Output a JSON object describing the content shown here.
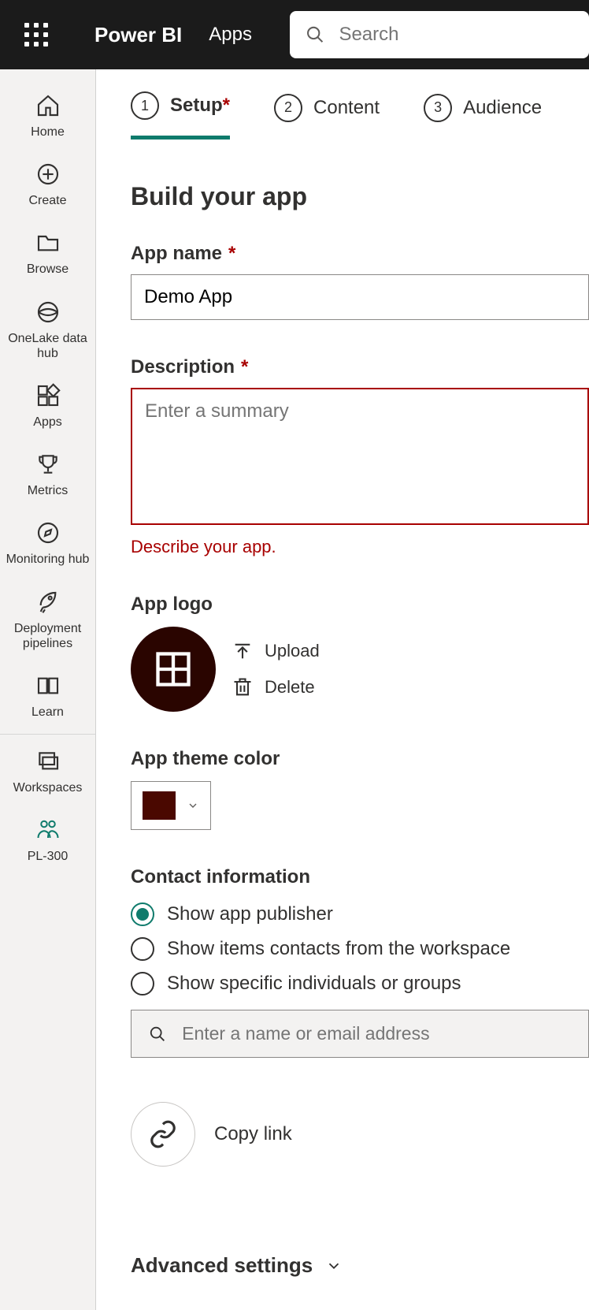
{
  "header": {
    "brand": "Power BI",
    "topnav": "Apps",
    "search_placeholder": "Search"
  },
  "rail": {
    "home": "Home",
    "create": "Create",
    "browse": "Browse",
    "onelake": "OneLake data hub",
    "apps": "Apps",
    "metrics": "Metrics",
    "monitoring": "Monitoring hub",
    "deploy": "Deployment pipelines",
    "learn": "Learn",
    "workspaces": "Workspaces",
    "current_ws": "PL-300"
  },
  "wizard": {
    "step1_num": "1",
    "step1_label": "Setup",
    "step2_num": "2",
    "step2_label": "Content",
    "step3_num": "3",
    "step3_label": "Audience"
  },
  "page": {
    "title": "Build your app",
    "app_name_label": "App name",
    "app_name_value": "Demo App",
    "desc_label": "Description",
    "desc_placeholder": "Enter a summary",
    "desc_error": "Describe your app.",
    "logo_label": "App logo",
    "upload": "Upload",
    "delete": "Delete",
    "theme_label": "App theme color",
    "theme_color": "#4a0800",
    "contact_label": "Contact information",
    "contact_opt1": "Show app publisher",
    "contact_opt2": "Show items contacts from the workspace",
    "contact_opt3": "Show specific individuals or groups",
    "people_placeholder": "Enter a name or email address",
    "copy_link": "Copy link",
    "advanced": "Advanced settings"
  },
  "colors": {
    "accent": "#0f7b6c",
    "error": "#a80000"
  }
}
